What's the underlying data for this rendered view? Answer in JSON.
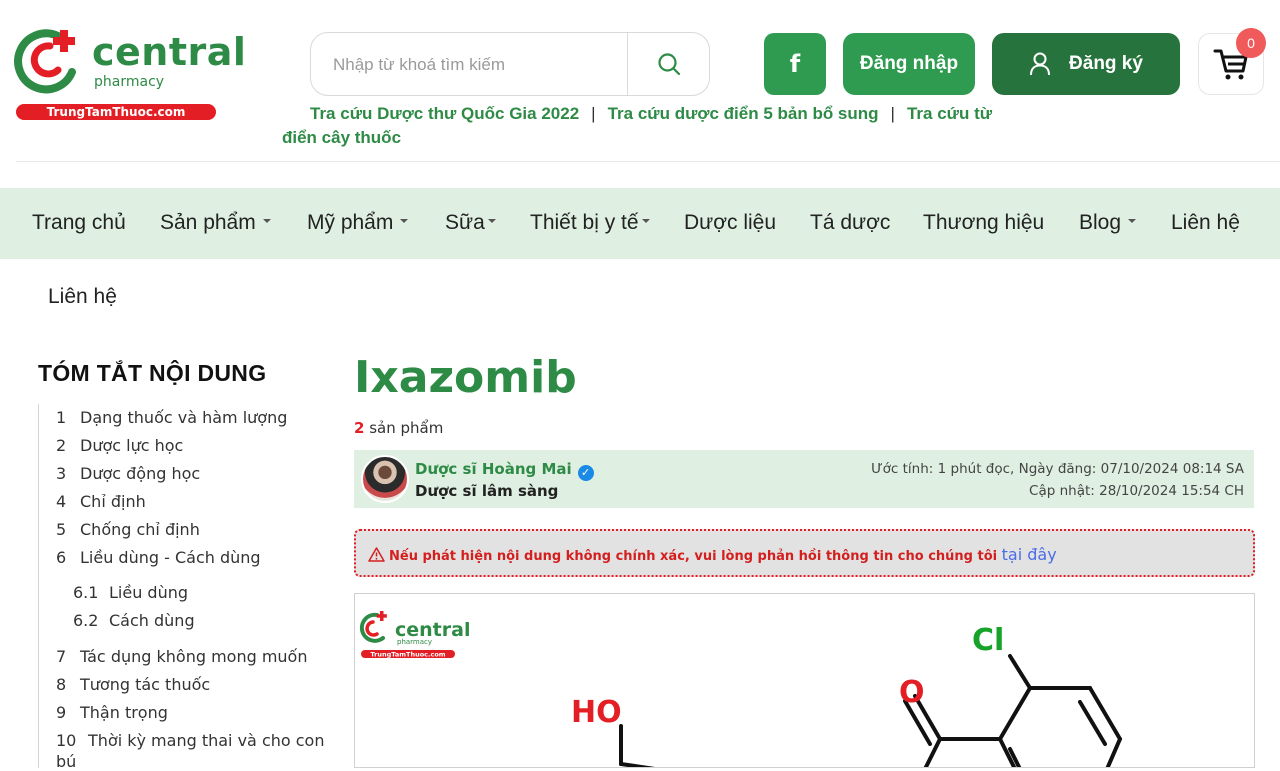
{
  "brand": {
    "name": "central",
    "sub": "pharmacy",
    "domain": "TrungTamThuoc.com",
    "color": "#2e8b46",
    "accent": "#e31e24"
  },
  "search": {
    "placeholder": "Nhập từ khoá tìm kiếm",
    "icon": "search-icon"
  },
  "header": {
    "facebook_label": "f",
    "login_label": "Đăng nhập",
    "register_label": "Đăng ký",
    "cart_count": "0"
  },
  "quick_links": [
    "Tra cứu Dược thư Quốc Gia 2022",
    "Tra cứu dược điển 5 bản bổ sung",
    "Tra cứu từ điển cây thuốc"
  ],
  "quick_link_separator": "|",
  "nav": [
    {
      "label": "Trang chủ"
    },
    {
      "label": "Sản phẩm"
    },
    {
      "label": "Mỹ phẩm"
    },
    {
      "label": "Sữa"
    },
    {
      "label": "Thiết bị y tế"
    },
    {
      "label": "Dược liệu"
    },
    {
      "label": "Tá dược"
    },
    {
      "label": "Thương hiệu"
    },
    {
      "label": "Blog"
    },
    {
      "label": "Liên hệ"
    }
  ],
  "breadcrumb": "Liên hệ",
  "toc": {
    "title": "TÓM TẮT NỘI DUNG",
    "items": [
      {
        "num": "1",
        "label": "Dạng thuốc và hàm lượng"
      },
      {
        "num": "2",
        "label": "Dược lực học"
      },
      {
        "num": "3",
        "label": "Dược động học"
      },
      {
        "num": "4",
        "label": "Chỉ định"
      },
      {
        "num": "5",
        "label": "Chống chỉ định"
      },
      {
        "num": "6",
        "label": "Liều dùng - Cách dùng"
      },
      {
        "num": "6.1",
        "label": "Liều dùng"
      },
      {
        "num": "6.2",
        "label": "Cách dùng"
      },
      {
        "num": "7",
        "label": "Tác dụng không mong muốn"
      },
      {
        "num": "8",
        "label": "Tương tác thuốc"
      },
      {
        "num": "9",
        "label": "Thận trọng"
      },
      {
        "num": "10",
        "label": "Thời kỳ mang thai và cho con"
      },
      {
        "num": "",
        "label": "bú"
      }
    ]
  },
  "article": {
    "title": "Ixazomib",
    "product_count": "2",
    "product_label": "sản phẩm",
    "author_name": "Dược sĩ Hoàng Mai",
    "author_role": "Dược sĩ lâm sàng",
    "meta_line1": "Ước tính: 1 phút đọc, Ngày đăng: 07/10/2024 08:14 SA",
    "meta_line2": "Cập nhật: 28/10/2024 15:54 CH",
    "warning_text": "Nếu phát hiện nội dung không chính xác, vui lòng phản hồi thông tin cho chúng tôi",
    "warning_link": "tại đây"
  },
  "figure": {
    "watermark_name": "central",
    "watermark_sub": "pharmacy",
    "watermark_domain": "TrungTamThuoc.com",
    "labels": {
      "cl": "Cl",
      "o": "O",
      "ho": "HO"
    }
  }
}
